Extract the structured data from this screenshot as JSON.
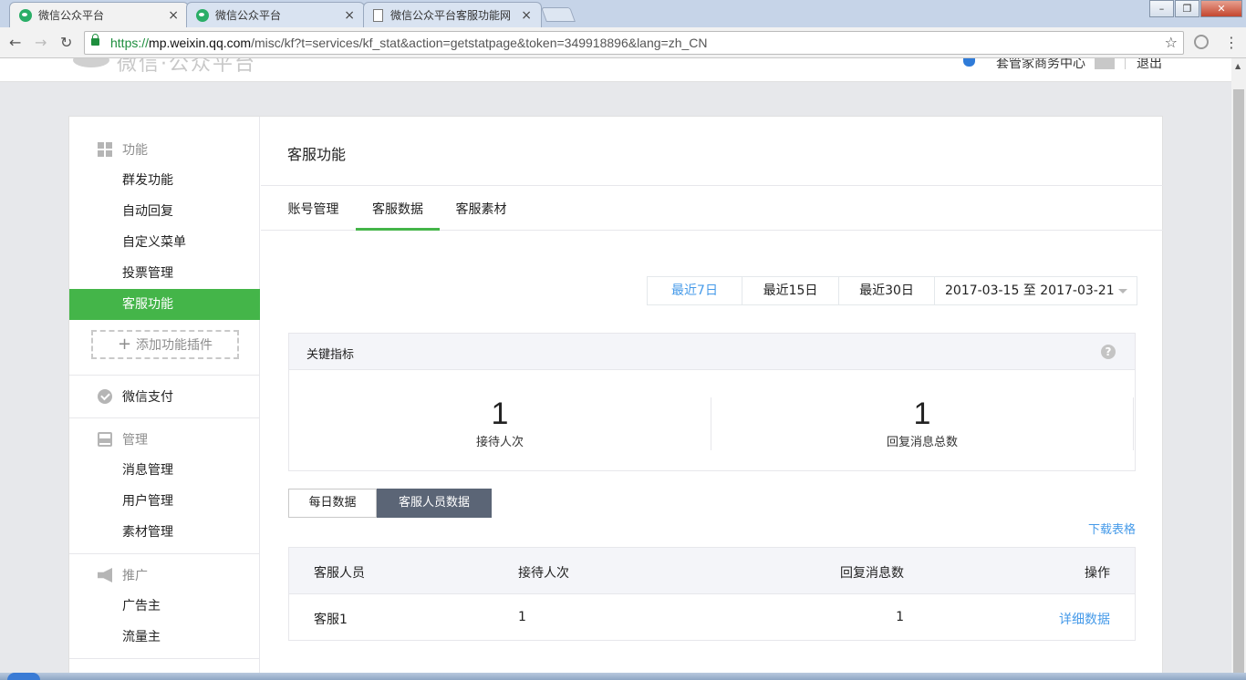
{
  "browser": {
    "tabs": [
      {
        "title": "微信公众平台",
        "close": "×",
        "icon": "wechat-icon"
      },
      {
        "title": "微信公众平台",
        "close": "×",
        "icon": "wechat-icon"
      },
      {
        "title": "微信公众平台客服功能网",
        "close": "×",
        "icon": "page-icon"
      }
    ],
    "window_controls": {
      "minimize": "–",
      "maximize": "❐",
      "close": "✕"
    },
    "nav": {
      "back": "←",
      "forward": "→",
      "reload": "↻",
      "star": "☆",
      "menu": "⋮"
    },
    "url": {
      "scheme": "https://",
      "host": "mp.weixin.qq.com",
      "path": "/misc/kf?t=services/kf_stat&action=getstatpage&token=349918896&lang=zh_CN"
    }
  },
  "header": {
    "logo": "微信·公众平台",
    "biz_center": "套管家商务中心",
    "logout": "退出"
  },
  "sidebar": {
    "sections": [
      {
        "title": "功能",
        "icon": "grid-icon",
        "items": [
          "群发功能",
          "自动回复",
          "自定义菜单",
          "投票管理",
          "客服功能"
        ]
      },
      {
        "title": "微信支付",
        "icon": "wechat-pay-icon",
        "items": []
      },
      {
        "title": "管理",
        "icon": "inbox-icon",
        "items": [
          "消息管理",
          "用户管理",
          "素材管理"
        ]
      },
      {
        "title": "推广",
        "icon": "megaphone-icon",
        "items": [
          "广告主",
          "流量主"
        ]
      }
    ],
    "selected_item": "客服功能",
    "add_plugin": "添加功能插件",
    "plus": "+"
  },
  "main": {
    "title": "客服功能",
    "tabs": [
      {
        "label": "账号管理"
      },
      {
        "label": "客服数据"
      },
      {
        "label": "客服素材"
      }
    ],
    "selected_tab": "客服数据",
    "range_buttons": [
      "最近7日",
      "最近15日",
      "最近30日"
    ],
    "active_range": "最近7日",
    "date_range": "2017-03-15 至 2017-03-21",
    "kpi": {
      "title": "关键指标",
      "help": "?",
      "items": [
        {
          "value": "1",
          "label": "接待人次"
        },
        {
          "value": "1",
          "label": "回复消息总数"
        }
      ]
    },
    "view_tabs": [
      "每日数据",
      "客服人员数据"
    ],
    "active_view": "客服人员数据",
    "download": "下载表格",
    "table": {
      "headers": [
        "客服人员",
        "接待人次",
        "回复消息数",
        "操作"
      ],
      "rows": [
        {
          "agent": "客服1",
          "sessions": "1",
          "replies": "1",
          "action": "详细数据"
        }
      ]
    }
  },
  "colors": {
    "accent_green": "#44b549",
    "link_blue": "#459ae9",
    "active_segment": "#5b6576"
  }
}
